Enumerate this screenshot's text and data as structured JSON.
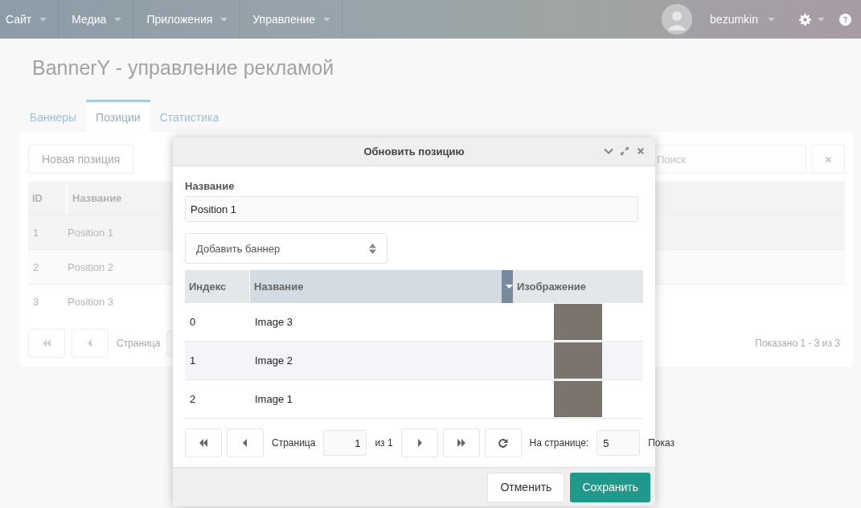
{
  "navbar": {
    "menus": [
      {
        "label": "Сайт"
      },
      {
        "label": "Медиа"
      },
      {
        "label": "Приложения"
      },
      {
        "label": "Управление"
      }
    ],
    "user": {
      "name": "bezumkin"
    }
  },
  "page": {
    "title": "BannerY - управление рекламой"
  },
  "tabs": [
    {
      "label": "Баннеры",
      "selected": false
    },
    {
      "label": "Позиции",
      "selected": true
    },
    {
      "label": "Статистика",
      "selected": false
    }
  ],
  "toolbar": {
    "new_button": "Новая позиция",
    "search": {
      "placeholder": "Поиск"
    }
  },
  "table": {
    "columns": [
      "ID",
      "Название"
    ],
    "rows": [
      {
        "id": "1",
        "name": "Position 1"
      },
      {
        "id": "2",
        "name": "Position 2"
      },
      {
        "id": "3",
        "name": "Position 3"
      }
    ]
  },
  "pager": {
    "page_label": "Страница",
    "summary": "Показано 1 - 3 из 3"
  },
  "dialog": {
    "title": "Обновить позицию",
    "name_label": "Название",
    "name_value": "Position 1",
    "add_select": {
      "placeholder": "Добавить баннер"
    },
    "grid": {
      "columns": [
        "Индекс",
        "Название",
        "Изображение"
      ],
      "rows": [
        {
          "index": "0",
          "name": "Image 3"
        },
        {
          "index": "1",
          "name": "Image 2"
        },
        {
          "index": "2",
          "name": "Image 1"
        }
      ]
    },
    "pager": {
      "page_label": "Страница",
      "page": "1",
      "of": "из 1",
      "per_page_label": "На странице:",
      "per_page": "5",
      "info": "Показ"
    },
    "buttons": {
      "cancel": "Отменить",
      "save": "Сохранить"
    }
  }
}
